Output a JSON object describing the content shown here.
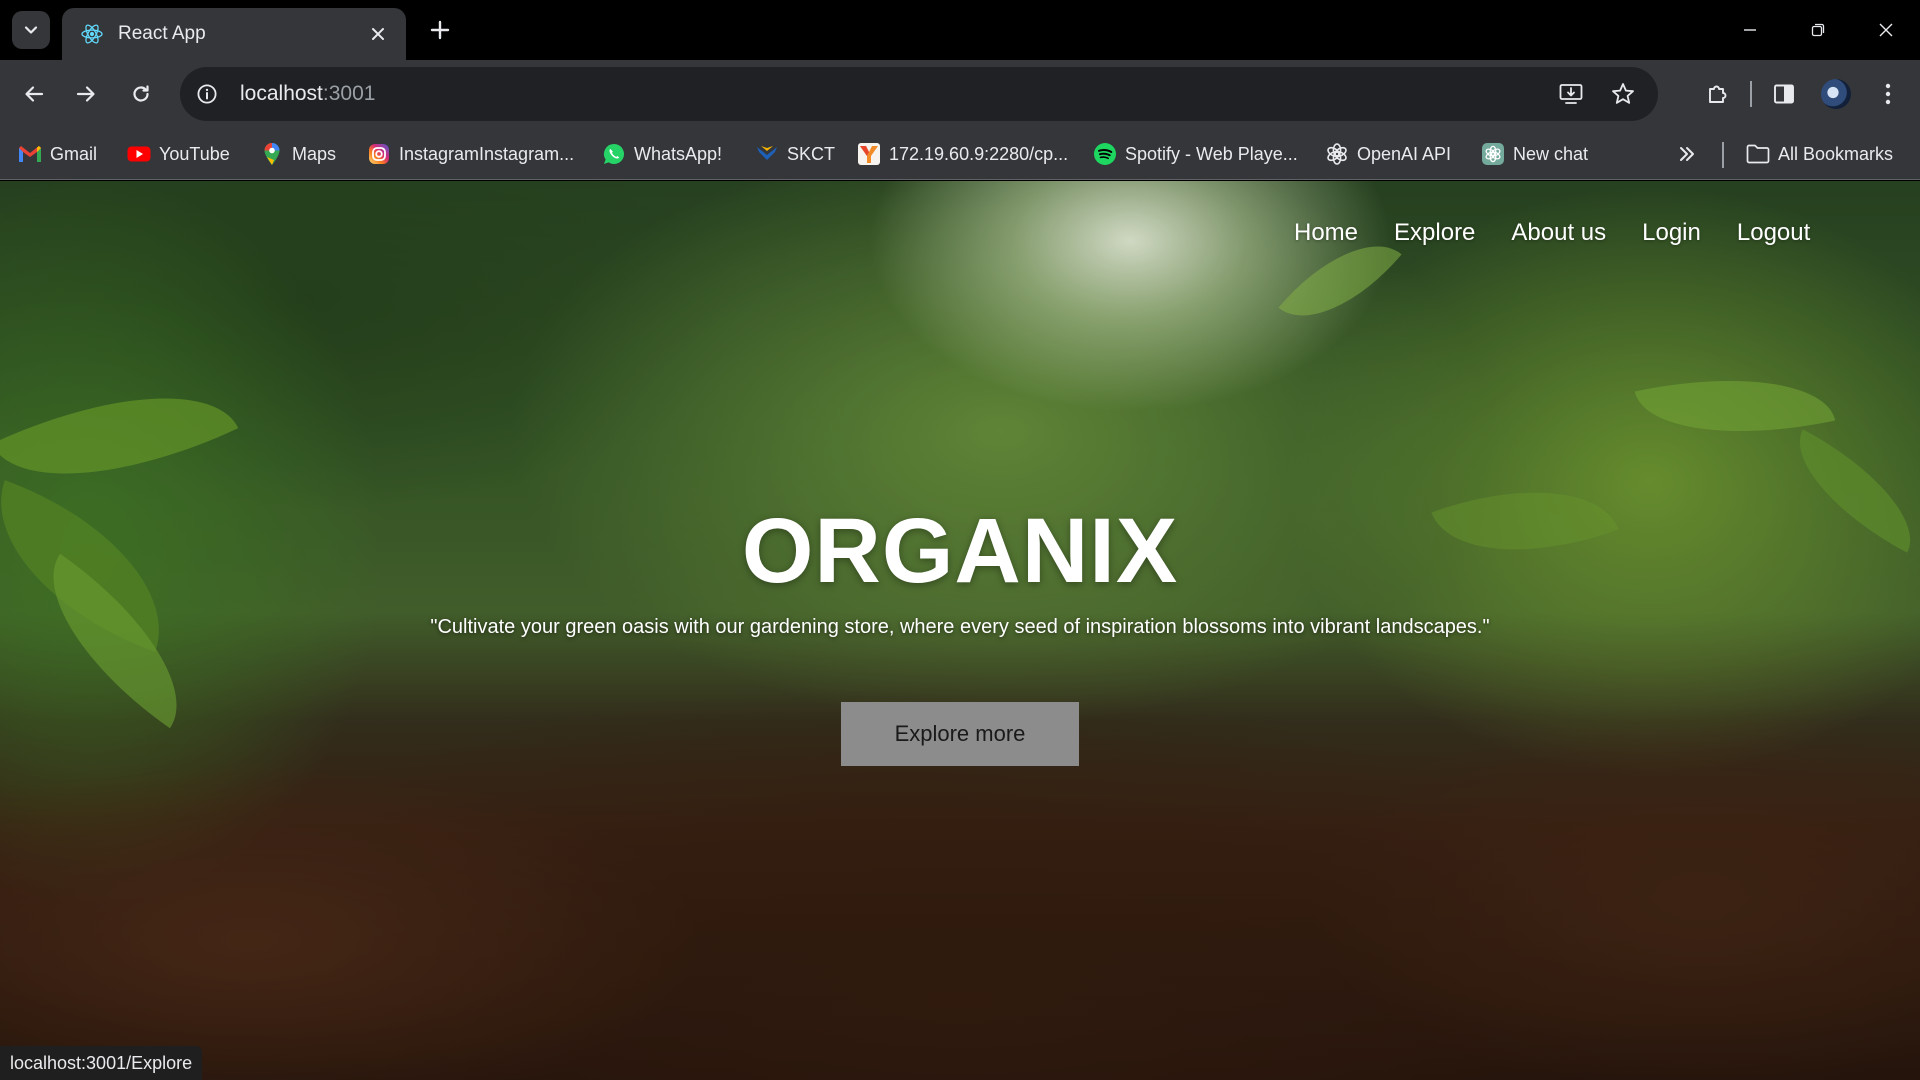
{
  "window": {
    "tab_title": "React App"
  },
  "toolbar": {
    "url_host": "localhost",
    "url_port": ":3001"
  },
  "bookmarks": {
    "items": [
      {
        "label": "Gmail",
        "icon": "gmail-icon"
      },
      {
        "label": "YouTube",
        "icon": "youtube-icon"
      },
      {
        "label": "Maps",
        "icon": "maps-icon"
      },
      {
        "label": "InstagramInstagram...",
        "icon": "instagram-icon"
      },
      {
        "label": "WhatsApp!",
        "icon": "whatsapp-icon"
      },
      {
        "label": "SKCT",
        "icon": "skct-icon"
      },
      {
        "label": "172.19.60.9:2280/cp...",
        "icon": "router-icon"
      },
      {
        "label": "Spotify - Web Playe...",
        "icon": "spotify-icon"
      },
      {
        "label": "OpenAI API",
        "icon": "openai-icon"
      },
      {
        "label": "New chat",
        "icon": "chatgpt-icon"
      }
    ],
    "all_bookmarks": "All Bookmarks"
  },
  "site": {
    "nav": [
      "Home",
      "Explore",
      "About us",
      "Login",
      "Logout"
    ],
    "title": "ORGANIX",
    "tagline": "\"Cultivate your green oasis with our gardening store, where every seed of inspiration blossoms into vibrant landscapes.\"",
    "cta": "Explore more"
  },
  "status_bar": {
    "link_preview": "localhost:3001/Explore"
  },
  "colors": {
    "chrome_dark": "#35363a",
    "omnibox": "#202124",
    "button_grey": "#8c8c8c"
  }
}
